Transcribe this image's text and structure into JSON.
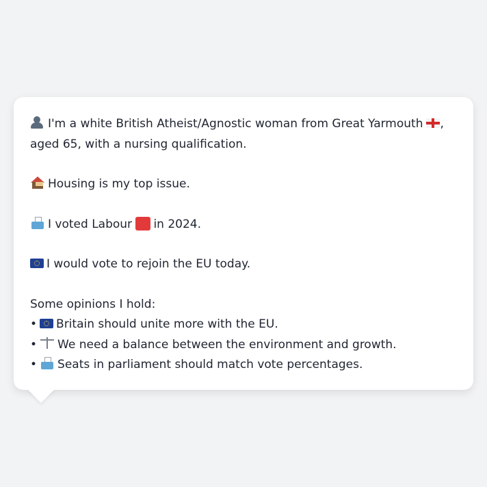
{
  "bio": {
    "intro_before_flag": "I'm a white British Atheist/Agnostic woman from Great Yarmouth",
    "intro_after_flag": ", aged 65, with a nursing qualification.",
    "housing": "Housing is my top issue.",
    "voted_before": "I voted Labour",
    "voted_after": "in 2024.",
    "eu_vote": "I would vote to rejoin the EU today."
  },
  "opinions": {
    "heading": "Some opinions I hold:",
    "bullet": "•",
    "items": [
      {
        "icon": "eu-flag-icon",
        "text": "Britain should unite more with the EU."
      },
      {
        "icon": "scales-icon",
        "text": "We need a balance between the environment and growth."
      },
      {
        "icon": "ballot-box-icon",
        "text": "Seats in parliament should match vote percentages."
      }
    ]
  },
  "colors": {
    "background": "#f2f3f5",
    "bubble": "#ffffff",
    "text": "#1f2430",
    "labour_red": "#e23a3a",
    "eu_blue": "#1f3f93"
  }
}
